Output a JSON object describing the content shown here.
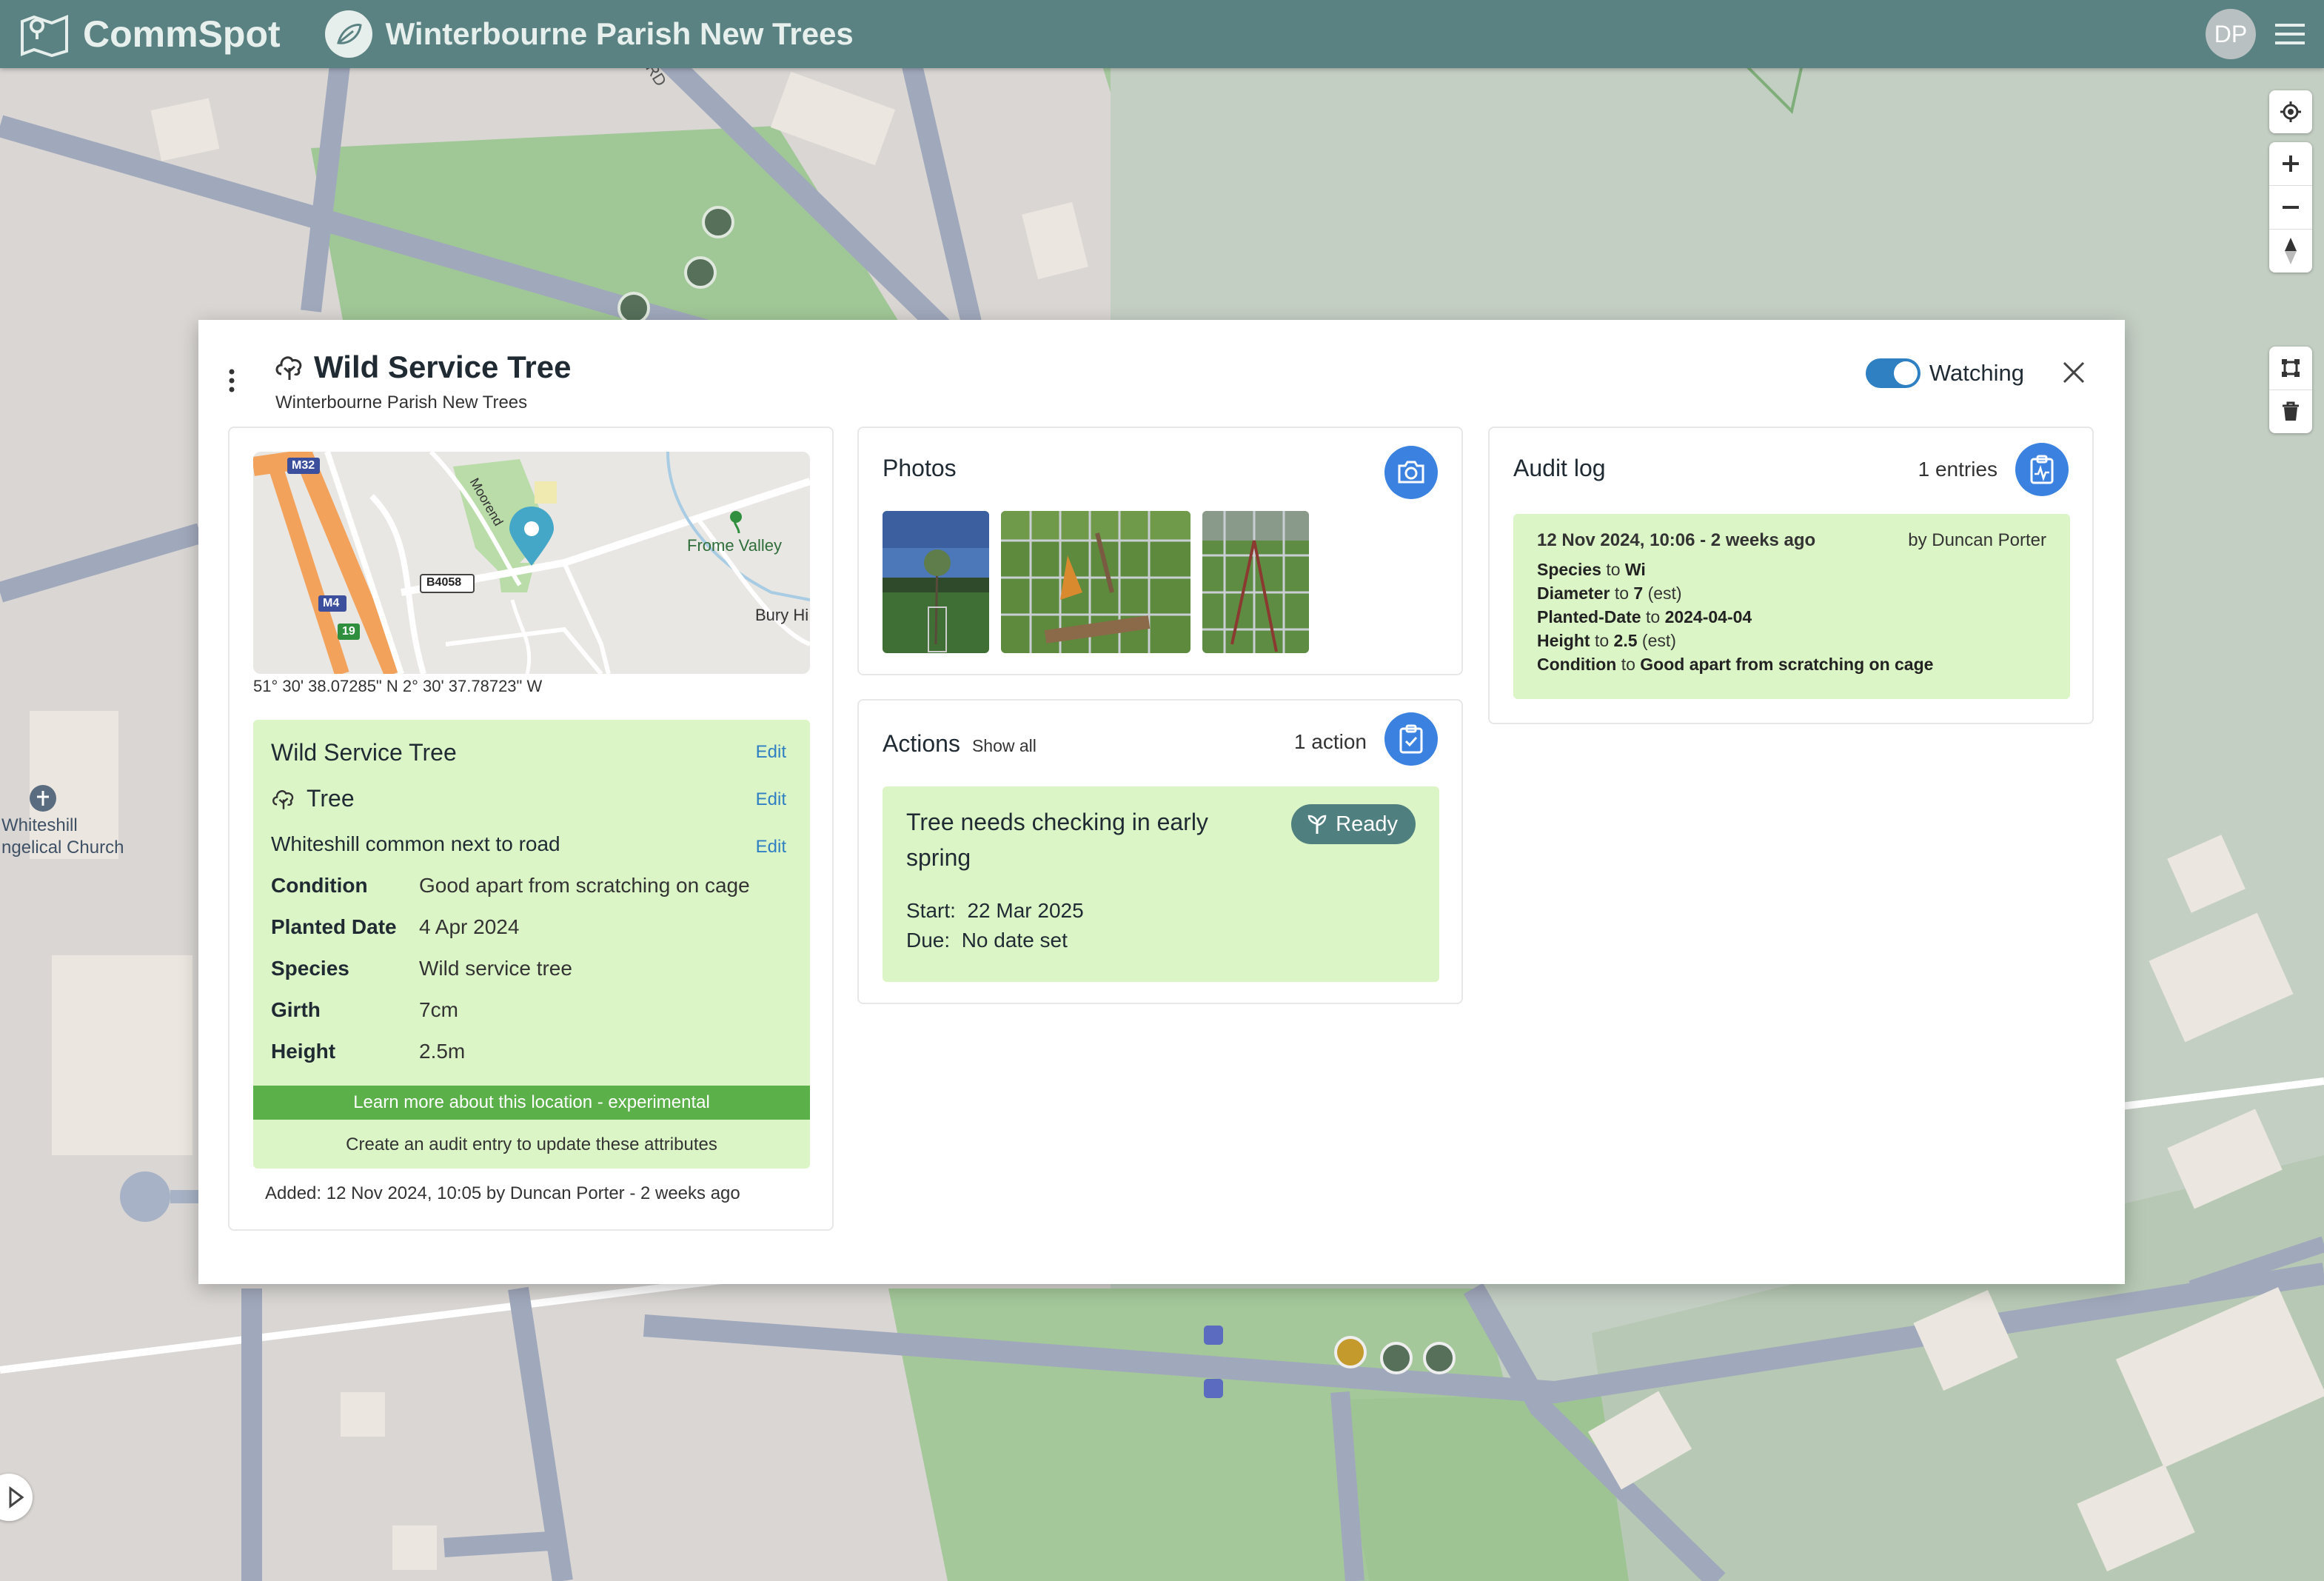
{
  "topbar": {
    "brand": "CommSpot",
    "project": "Winterbourne Parish New Trees",
    "avatar_initials": "DP"
  },
  "map": {
    "road_label": "RD",
    "place_label_1": "Whiteshill",
    "place_label_2": "ngelical Church"
  },
  "modal": {
    "title": "Wild Service Tree",
    "subtitle": "Winterbourne Parish New Trees",
    "watching_label": "Watching",
    "watching_on": true
  },
  "location": {
    "coords": "51° 30' 38.07285\" N 2° 30' 37.78723\" W",
    "minimap_labels": {
      "m32": "M32",
      "m4": "M4",
      "b4058": "B4058",
      "junction": "19",
      "road": "Moorend",
      "frome_valley": "Frome Valley",
      "bury_hill": "Bury Hi"
    }
  },
  "attributes": {
    "name": "Wild Service Tree",
    "type": "Tree",
    "description": "Whiteshill common next to road",
    "edit_label": "Edit",
    "rows": [
      {
        "label": "Condition",
        "value": "Good apart from scratching on cage"
      },
      {
        "label": "Planted Date",
        "value": "4 Apr 2024"
      },
      {
        "label": "Species",
        "value": "Wild service tree"
      },
      {
        "label": "Girth",
        "value": "7cm"
      },
      {
        "label": "Height",
        "value": "2.5m"
      }
    ],
    "learn_more": "Learn more about this location - experimental",
    "create_audit": "Create an audit entry to update these attributes",
    "added": "Added: 12 Nov 2024, 10:05 by Duncan Porter - 2 weeks ago"
  },
  "photos": {
    "title": "Photos"
  },
  "actions": {
    "title": "Actions",
    "show_all": "Show all",
    "count": "1 action",
    "item": {
      "title": "Tree needs checking in early spring",
      "status": "Ready",
      "start": "Start:  22 Mar 2025",
      "due": "Due:  No date set"
    }
  },
  "audit": {
    "title": "Audit log",
    "count": "1 entries",
    "entry": {
      "date": "12 Nov 2024, 10:06 - 2 weeks ago",
      "by": "by Duncan Porter",
      "changes": [
        {
          "field": "Species",
          "to": "to",
          "value": "Wi",
          "suffix": ""
        },
        {
          "field": "Diameter",
          "to": "to",
          "value": "7",
          "suffix": "(est)"
        },
        {
          "field": "Planted-Date",
          "to": "to",
          "value": "2024-04-04",
          "suffix": ""
        },
        {
          "field": "Height",
          "to": "to",
          "value": "2.5",
          "suffix": "(est)"
        },
        {
          "field": "Condition",
          "to": "to",
          "value": "Good apart from scratching on cage",
          "suffix": ""
        }
      ]
    }
  },
  "colors": {
    "topbar": "#5a8282",
    "accent": "#3b82e0",
    "card_green": "#dcf5c6",
    "learn_bar": "#5bb04a",
    "ready_badge": "#4f7f7f",
    "toggle": "#2f7fc3"
  }
}
